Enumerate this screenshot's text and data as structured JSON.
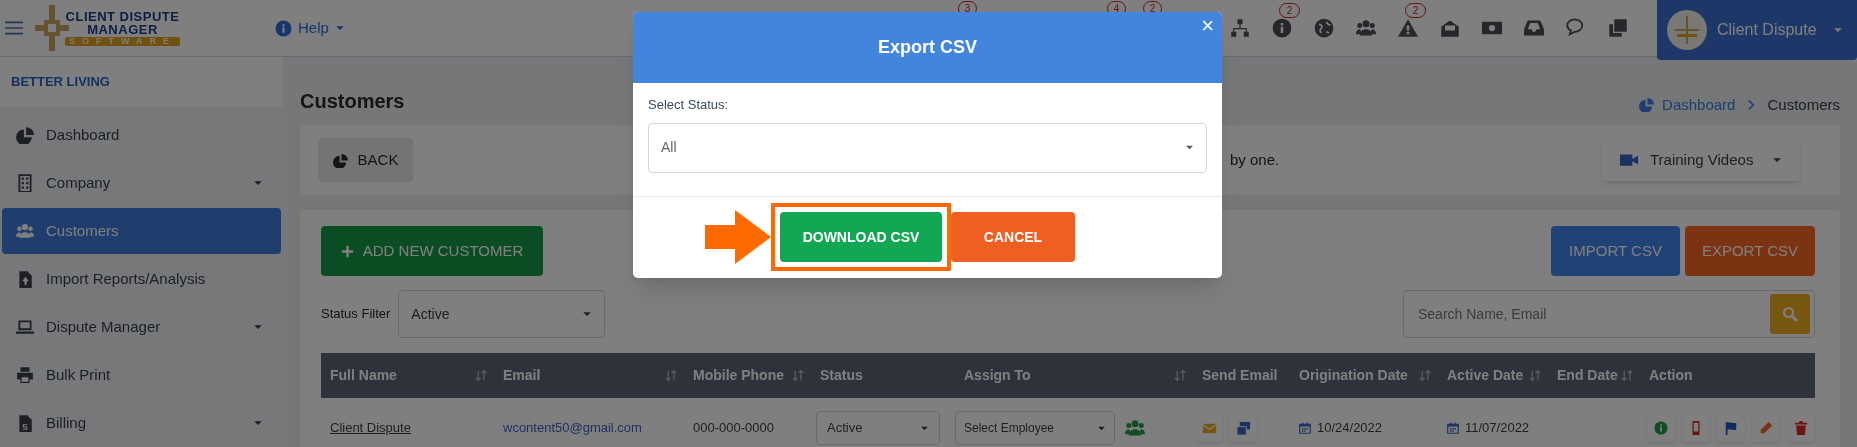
{
  "topbar": {
    "logo": {
      "line_1": "CLIENT DISPUTE",
      "line_2": "MANAGER",
      "line_3": "SOFTWARE"
    },
    "help": "Help",
    "hidden_badges": [
      "3",
      "4",
      "2"
    ],
    "icons": [
      {
        "kind": "sitemap"
      },
      {
        "kind": "info",
        "badge": "2"
      },
      {
        "kind": "globe"
      },
      {
        "kind": "users"
      },
      {
        "kind": "warning",
        "badge": "2"
      },
      {
        "kind": "mail"
      },
      {
        "kind": "money"
      },
      {
        "kind": "inbox"
      },
      {
        "kind": "comments"
      },
      {
        "kind": "copy"
      }
    ],
    "profile": "Client Dispute"
  },
  "sidebar": {
    "company": "BETTER LIVING",
    "items": [
      {
        "label": "Dashboard",
        "expandable": false,
        "selected": false
      },
      {
        "label": "Company",
        "expandable": true,
        "selected": false
      },
      {
        "label": "Customers",
        "expandable": false,
        "selected": true
      },
      {
        "label": "Import Reports/Analysis",
        "expandable": false,
        "selected": false
      },
      {
        "label": "Dispute Manager",
        "expandable": true,
        "selected": false
      },
      {
        "label": "Bulk Print",
        "expandable": false,
        "selected": false
      },
      {
        "label": "Billing",
        "expandable": true,
        "selected": false
      }
    ]
  },
  "page": {
    "title": "Customers",
    "breadcrumb": [
      {
        "label": "Dashboard",
        "link": true
      },
      {
        "label": "Customers",
        "link": false
      }
    ],
    "back": "BACK",
    "notice": "by one.",
    "training": "Training Videos"
  },
  "toolbar": {
    "add": "ADD NEW CUSTOMER",
    "import": "IMPORT CSV",
    "export": "EXPORT CSV",
    "status_filter": {
      "label": "Status Filter",
      "value": "Active"
    },
    "search": {
      "placeholder": "Search Name, Email"
    }
  },
  "table": {
    "columns": [
      {
        "label": "Full Name",
        "sortable": true
      },
      {
        "label": "Email",
        "sortable": true
      },
      {
        "label": "Mobile Phone",
        "sortable": true
      },
      {
        "label": "Status",
        "sortable": false
      },
      {
        "label": "Assign To",
        "sortable": true
      },
      {
        "label": "Send Email",
        "sortable": false
      },
      {
        "label": "Origination Date",
        "sortable": true
      },
      {
        "label": "Active Date",
        "sortable": true
      },
      {
        "label": "End Date",
        "sortable": true
      },
      {
        "label": "Action",
        "sortable": false
      }
    ],
    "rows": [
      {
        "full_name": "Client Dispute",
        "email": "wcontent50@gmail.com",
        "mobile_phone": "000-000-0000",
        "status": "Active",
        "assign_to": "Select Employee",
        "origination_date": "10/24/2022",
        "active_date": "11/07/2022"
      }
    ]
  },
  "modal": {
    "title": "Export CSV",
    "close": "×",
    "field_label": "Select Status:",
    "value": "All",
    "download": "DOWNLOAD CSV",
    "download_highlighted": true,
    "cancel": "CANCEL"
  }
}
